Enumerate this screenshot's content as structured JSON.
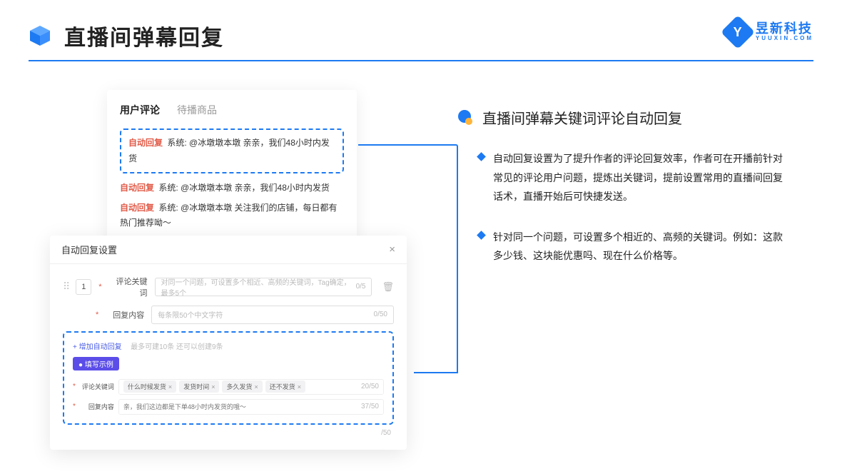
{
  "header": {
    "title": "直播间弹幕回复",
    "logo_cn": "昱新科技",
    "logo_en": "YUUXIN.COM",
    "logo_letter": "Y"
  },
  "card1": {
    "tabs": {
      "active": "用户评论",
      "inactive": "待播商品"
    },
    "highlight": {
      "badge": "自动回复",
      "text": "系统: @冰墩墩本墩 亲亲，我们48小时内发货"
    },
    "line2": {
      "badge": "自动回复",
      "text": "系统: @冰墩墩本墩 亲亲，我们48小时内发货"
    },
    "line3": {
      "badge": "自动回复",
      "text": "系统: @冰墩墩本墩 关注我们的店铺，每日都有热门推荐呦～"
    }
  },
  "card2": {
    "title": "自动回复设置",
    "close": "×",
    "row1": {
      "idx": "1",
      "label": "评论关键词",
      "placeholder": "对同一个问题，可设置多个相近、高频的关键词，Tag确定，最多5个",
      "counter": "0/5"
    },
    "row2": {
      "label": "回复内容",
      "placeholder": "每条限50个中文字符",
      "counter": "0/50"
    },
    "add_link": "+ 增加自动回复",
    "add_hint": "最多可建10条 还可以创建9条",
    "example_pill": "● 填写示例",
    "ex_row1": {
      "label": "评论关键词",
      "chips": [
        "什么时候发货",
        "发货时间",
        "多久发货",
        "还不发货"
      ],
      "counter": "20/50"
    },
    "ex_row2": {
      "label": "回复内容",
      "text": "亲，我们这边都是下单48小时内发货的哦～",
      "counter": "37/50"
    },
    "bottom_counter": "/50"
  },
  "right": {
    "section_title": "直播间弹幕关键词评论自动回复",
    "bullet1": "自动回复设置为了提升作者的评论回复效率，作者可在开播前针对常见的评论用户问题，提炼出关键词，提前设置常用的直播间回复话术，直播开始后可快捷发送。",
    "bullet2": "针对同一个问题，可设置多个相近的、高频的关键词。例如：这款多少钱、这块能优惠吗、现在什么价格等。"
  }
}
